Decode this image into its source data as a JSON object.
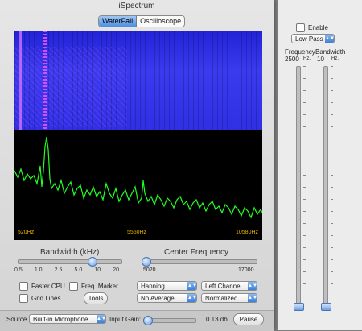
{
  "window": {
    "title": "iSpectrum"
  },
  "tabs": [
    {
      "label": "WaterFall",
      "active": true
    },
    {
      "label": "Oscilloscope",
      "active": false
    }
  ],
  "display": {
    "freq_left": "520Hz",
    "freq_mid": "5550Hz",
    "freq_right": "10580Hz"
  },
  "bandwidth": {
    "title": "Bandwidth (kHz)",
    "ticks": [
      "0.5",
      "1.0",
      "2.5",
      "5.0",
      "10",
      "20"
    ],
    "value": 0.72
  },
  "center": {
    "title": "Center Frequency",
    "min": "5020",
    "max": "17000",
    "value": 0.0
  },
  "options": {
    "faster_cpu": "Faster CPU",
    "freq_marker": "Freq. Marker",
    "grid_lines": "Grid Lines",
    "tools": "Tools"
  },
  "popups": {
    "window": "Hanning",
    "channel": "Left Channel",
    "average": "No Average",
    "scale": "Normalized"
  },
  "bottom": {
    "source_label": "Source",
    "source_value": "Built-in Microphone",
    "gain_label": "Input Gain:",
    "gain_value": "0.13 db",
    "pause": "Pause"
  },
  "filter": {
    "enable": "Enable",
    "type": "Low Pass",
    "frequency_label": "Frequency",
    "frequency_value": "2500",
    "frequency_unit": "Hz.",
    "bandwidth_label": "Bandwidth",
    "bandwidth_value": "10",
    "bandwidth_unit": "Hz."
  },
  "colors": {
    "spectrum": "#22ff22",
    "waterfall": "#2f2fe4",
    "freq_label": "#e8b000"
  }
}
